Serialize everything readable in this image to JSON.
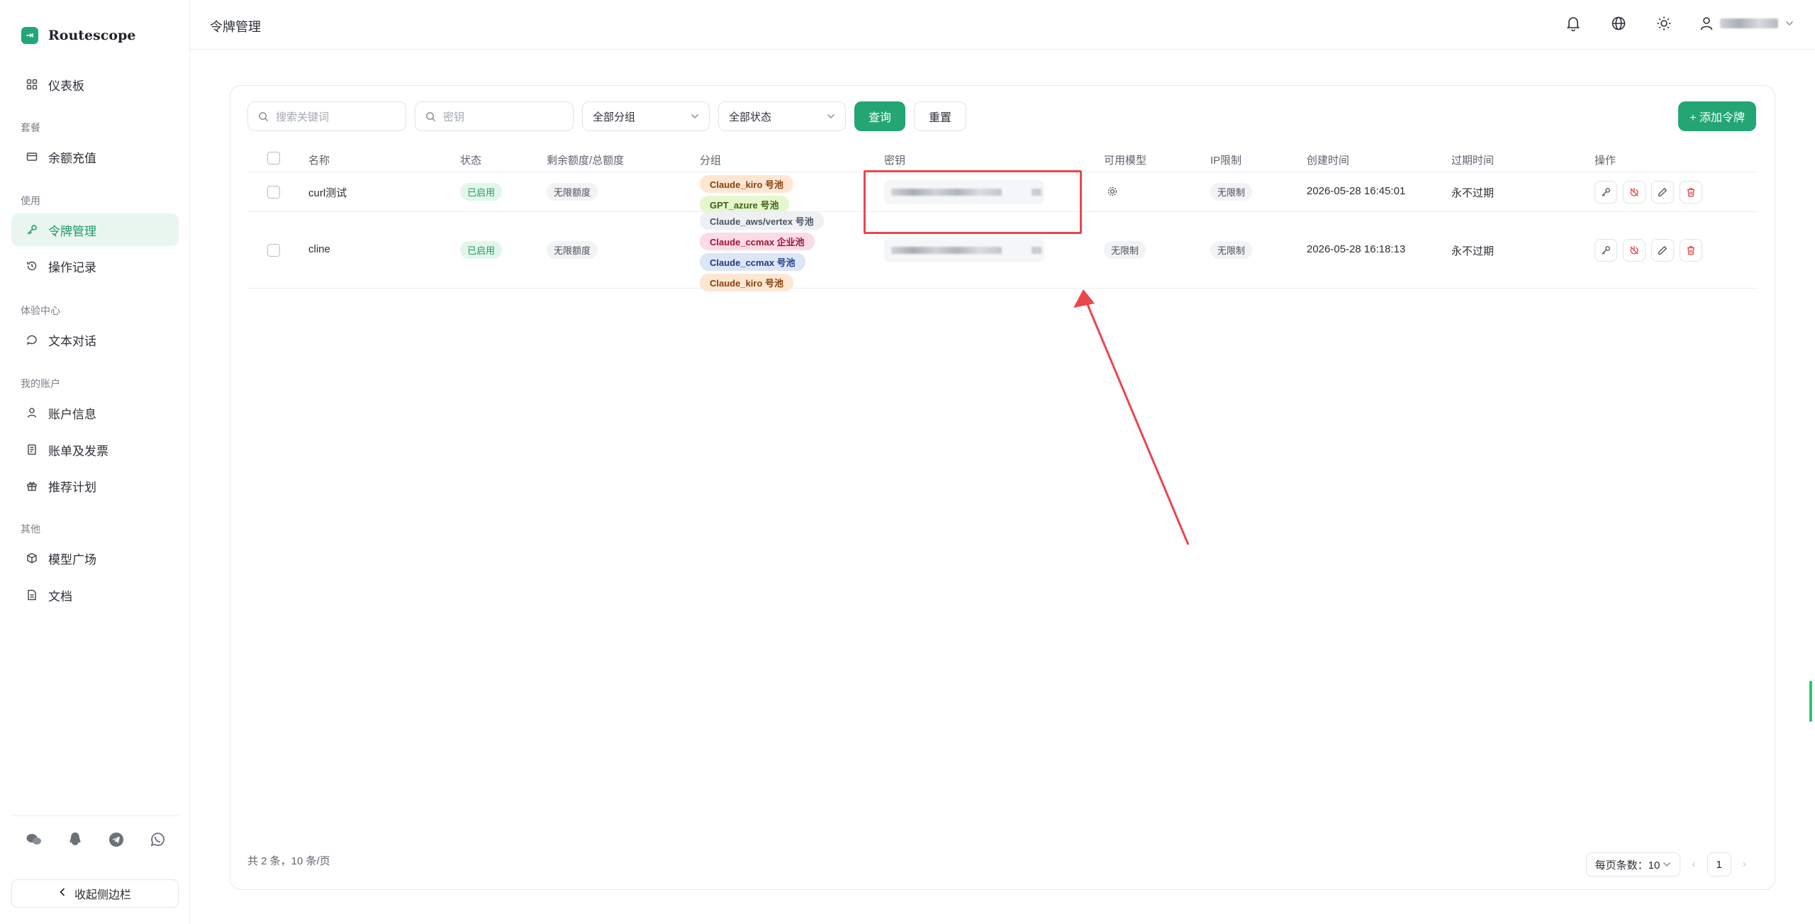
{
  "app": {
    "name": "Routescope",
    "logo_glyph": "⇥"
  },
  "sidebar": {
    "items": [
      {
        "id": "dashboard",
        "label": "仪表板",
        "icon": "grid-icon"
      },
      {
        "section": "套餐"
      },
      {
        "id": "topup",
        "label": "余额充值",
        "icon": "card-icon"
      },
      {
        "section": "使用"
      },
      {
        "id": "tokens",
        "label": "令牌管理",
        "icon": "key-icon",
        "active": true
      },
      {
        "id": "logs",
        "label": "操作记录",
        "icon": "history-icon"
      },
      {
        "section": "体验中心"
      },
      {
        "id": "chat",
        "label": "文本对话",
        "icon": "chat-icon"
      },
      {
        "section": "我的账户"
      },
      {
        "id": "account",
        "label": "账户信息",
        "icon": "user-icon"
      },
      {
        "id": "billing",
        "label": "账单及发票",
        "icon": "receipt-icon"
      },
      {
        "id": "referral",
        "label": "推荐计划",
        "icon": "gift-icon"
      },
      {
        "section": "其他"
      },
      {
        "id": "models",
        "label": "模型广场",
        "icon": "cube-icon"
      },
      {
        "id": "docs",
        "label": "文档",
        "icon": "document-icon"
      }
    ],
    "sections": {
      "plan": "套餐",
      "use": "使用",
      "experience": "体验中心",
      "account": "我的账户",
      "other": "其他"
    },
    "labels": {
      "dashboard": "仪表板",
      "topup": "余额充值",
      "tokens": "令牌管理",
      "logs": "操作记录",
      "chat": "文本对话",
      "account": "账户信息",
      "billing": "账单及发票",
      "referral": "推荐计划",
      "models": "模型广场",
      "docs": "文档"
    },
    "collapse_label": "收起侧边栏"
  },
  "header": {
    "title": "令牌管理"
  },
  "toolbar": {
    "search_placeholder": "搜索关键词",
    "key_placeholder": "密钥",
    "group_select": "全部分组",
    "status_select": "全部状态",
    "query_label": "查询",
    "reset_label": "重置",
    "add_label": "+ 添加令牌"
  },
  "table": {
    "columns": {
      "name": "名称",
      "status": "状态",
      "quota": "剩余额度/总额度",
      "group": "分组",
      "key": "密钥",
      "models": "可用模型",
      "ip": "IP限制",
      "created": "创建时间",
      "expires": "过期时间",
      "actions": "操作"
    },
    "rows": [
      {
        "name": "curl测试",
        "status": "已启用",
        "quota": "无限额度",
        "groups": [
          {
            "label": "Claude_kiro 号池",
            "bg": "#fde7d2",
            "fg": "#8a3d0a"
          },
          {
            "label": "GPT_azure 号池",
            "bg": "#e6f7cf",
            "fg": "#3f6212"
          }
        ],
        "models_icon": "gear-icon",
        "ip": "无限制",
        "created": "2026-05-28 16:45:01",
        "expires": "永不过期"
      },
      {
        "name": "cline",
        "status": "已启用",
        "quota": "无限额度",
        "groups": [
          {
            "label": "Claude_aws/vertex 号池",
            "bg": "#eef0f3",
            "fg": "#4b5563"
          },
          {
            "label": "Claude_ccmax 企业池",
            "bg": "#fbdbe6",
            "fg": "#9f1239"
          },
          {
            "label": "Claude_ccmax 号池",
            "bg": "#dde6f7",
            "fg": "#1e3a8a"
          },
          {
            "label": "Claude_kiro 号池",
            "bg": "#fde7d2",
            "fg": "#8a3d0a"
          }
        ],
        "models": "无限制",
        "ip": "无限制",
        "created": "2026-05-28 16:18:13",
        "expires": "永不过期"
      }
    ]
  },
  "footer": {
    "summary": "共 2 条，10 条/页",
    "page_size": "每页条数：10",
    "current_page": "1"
  },
  "colors": {
    "accent": "#23a574",
    "annotation": "#e9474c"
  }
}
